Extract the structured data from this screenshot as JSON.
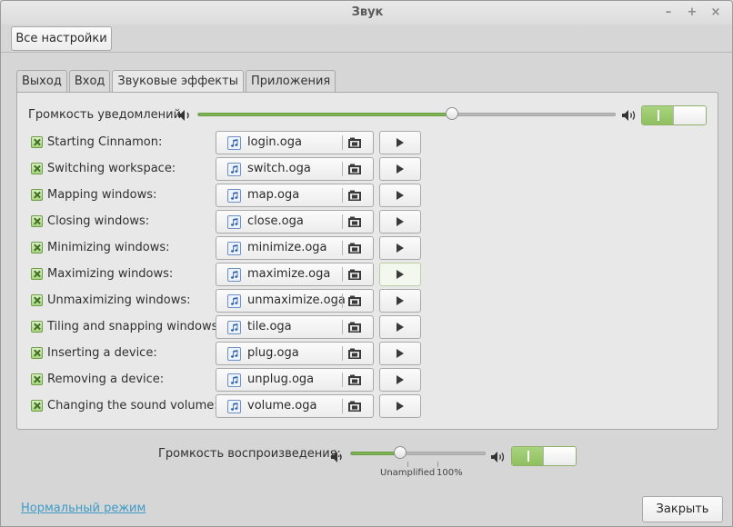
{
  "window": {
    "title": "Звук",
    "minimize": "–",
    "maximize": "+",
    "close": "×"
  },
  "toolbar": {
    "all_settings": "Все настройки"
  },
  "tabs": [
    {
      "label": "Выход"
    },
    {
      "label": "Вход"
    },
    {
      "label": "Звуковые эффекты",
      "active": true
    },
    {
      "label": "Приложения"
    }
  ],
  "notification_volume": {
    "label": "Громкость уведомлений:",
    "level_percent": 61,
    "enabled": true
  },
  "sounds": [
    {
      "label": "Starting Cinnamon:",
      "file": "login.oga",
      "enabled": true
    },
    {
      "label": "Switching workspace:",
      "file": "switch.oga",
      "enabled": true
    },
    {
      "label": "Mapping windows:",
      "file": "map.oga",
      "enabled": true
    },
    {
      "label": "Closing windows:",
      "file": "close.oga",
      "enabled": true
    },
    {
      "label": "Minimizing windows:",
      "file": "minimize.oga",
      "enabled": true
    },
    {
      "label": "Maximizing windows:",
      "file": "maximize.oga",
      "enabled": true
    },
    {
      "label": "Unmaximizing windows:",
      "file": "unmaximize.oga",
      "enabled": true
    },
    {
      "label": "Tiling and snapping windows:",
      "file": "tile.oga",
      "enabled": true
    },
    {
      "label": "Inserting a device:",
      "file": "plug.oga",
      "enabled": true
    },
    {
      "label": "Removing a device:",
      "file": "unplug.oga",
      "enabled": true
    },
    {
      "label": "Changing the sound volume:",
      "file": "volume.oga",
      "enabled": true
    }
  ],
  "playback_volume": {
    "label": "Громкость воспроизведения:",
    "level_percent": 37,
    "enabled": true,
    "tick_unamplified": "Unamplified",
    "tick_100": "100%"
  },
  "footer": {
    "normal_mode_link": "Нормальный режим",
    "close_button": "Закрыть"
  },
  "colors": {
    "accent_green": "#7eb552",
    "link_blue": "#3d9bc6",
    "background": "#d6d6d6"
  }
}
